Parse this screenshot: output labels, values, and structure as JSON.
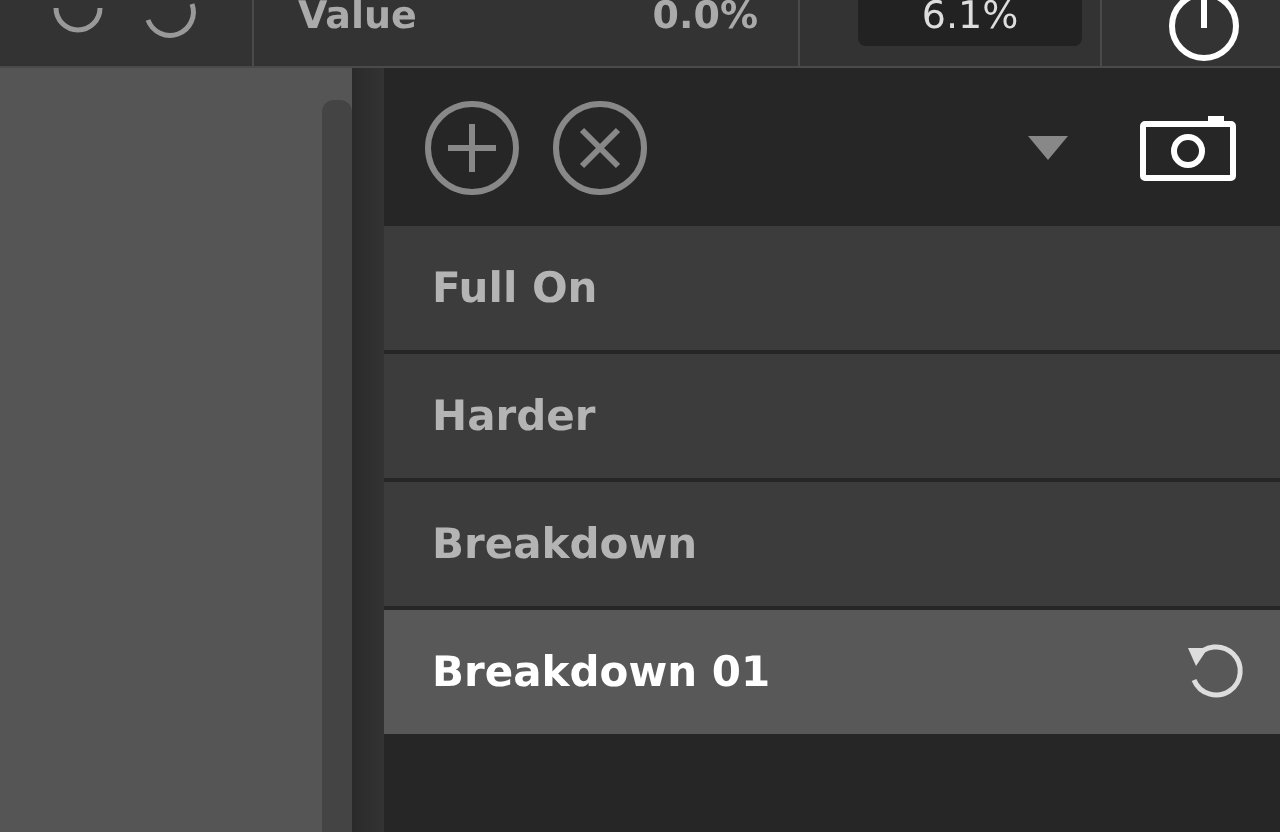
{
  "top_bar": {
    "label": "Value",
    "reading": "0.0%",
    "field_value": "6.1%"
  },
  "presets": [
    {
      "name": "Full On",
      "selected": false
    },
    {
      "name": "Harder",
      "selected": false
    },
    {
      "name": "Breakdown",
      "selected": false
    },
    {
      "name": "Breakdown 01",
      "selected": true
    }
  ]
}
